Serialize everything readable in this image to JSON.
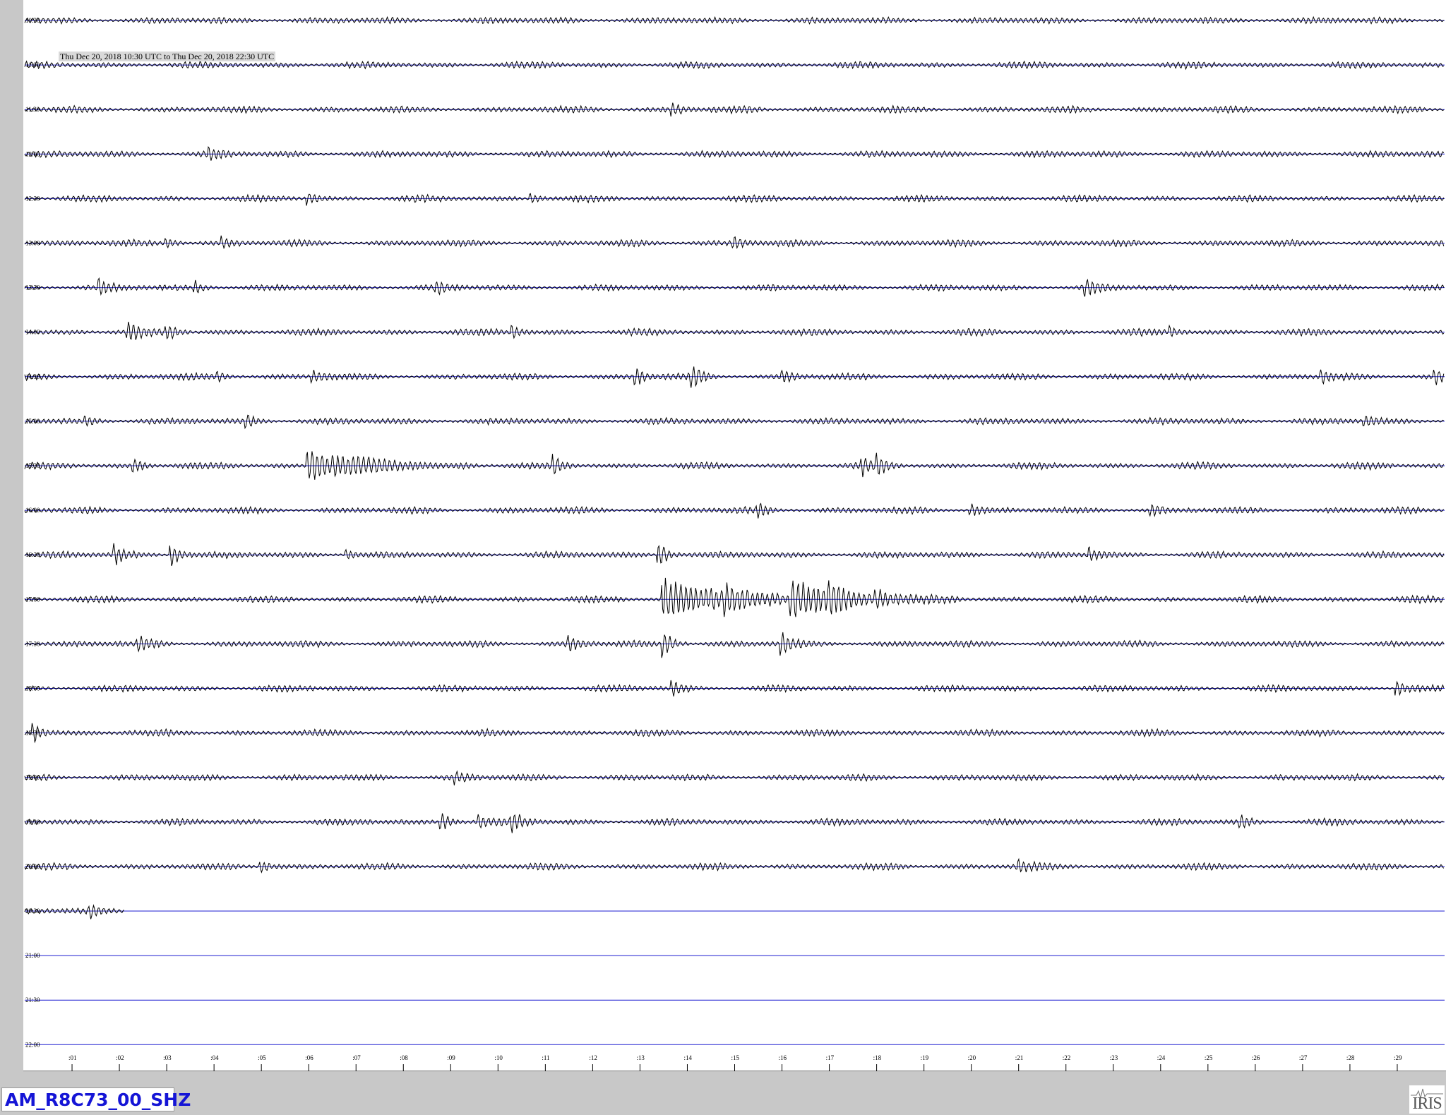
{
  "range_label": "Thu Dec 20, 2018 10:30 UTC to Thu Dec 20, 2018 22:30 UTC",
  "station": "AM_R8C73_00_SHZ",
  "logo_text": "IRIS",
  "colors": {
    "trace": "#000000",
    "baseline": "#1d1dd0",
    "background": "#ffffff",
    "frame": "#c8c8c8",
    "station_text": "#1515d6"
  },
  "chart_data": {
    "type": "line",
    "title": "",
    "x_axis_unit": "minutes after row start",
    "xlim": [
      0,
      30
    ],
    "x_ticks": [
      ":01",
      ":02",
      ":03",
      ":04",
      ":05",
      ":06",
      ":07",
      ":08",
      ":09",
      ":10",
      ":11",
      ":12",
      ":13",
      ":14",
      ":15",
      ":16",
      ":17",
      ":18",
      ":19",
      ":20",
      ":21",
      ":22",
      ":23",
      ":24",
      ":25",
      ":26",
      ":27",
      ":28",
      ":29"
    ],
    "rows": [
      {
        "label": "10:30",
        "data_end_min": 30,
        "events": []
      },
      {
        "label": "11:00",
        "data_end_min": 30,
        "events": []
      },
      {
        "label": "11:30",
        "data_end_min": 30,
        "events": [
          {
            "min": 13.7,
            "amp": 1.2
          }
        ]
      },
      {
        "label": "12:00",
        "data_end_min": 30,
        "events": [
          {
            "min": 3.9,
            "amp": 1.4
          }
        ]
      },
      {
        "label": "12:30",
        "data_end_min": 30,
        "events": [
          {
            "min": 6.0,
            "amp": 1.2
          },
          {
            "min": 10.7,
            "amp": 1.2
          }
        ]
      },
      {
        "label": "13:00",
        "data_end_min": 30,
        "events": [
          {
            "min": 3.0,
            "amp": 1.0
          },
          {
            "min": 4.2,
            "amp": 1.1
          },
          {
            "min": 15.0,
            "amp": 1.2
          }
        ]
      },
      {
        "label": "13:30",
        "data_end_min": 30,
        "events": [
          {
            "min": 1.6,
            "amp": 1.6
          },
          {
            "min": 3.6,
            "amp": 1.3
          },
          {
            "min": 8.7,
            "amp": 1.2
          },
          {
            "min": 22.4,
            "amp": 2.0
          }
        ]
      },
      {
        "label": "14:00",
        "data_end_min": 30,
        "events": [
          {
            "min": 2.2,
            "amp": 2.0
          },
          {
            "min": 3.0,
            "amp": 1.6
          },
          {
            "min": 10.3,
            "amp": 1.3
          },
          {
            "min": 24.2,
            "amp": 1.1
          }
        ]
      },
      {
        "label": "14:30",
        "data_end_min": 30,
        "events": [
          {
            "min": 4.1,
            "amp": 1.1
          },
          {
            "min": 6.1,
            "amp": 1.4
          },
          {
            "min": 12.9,
            "amp": 2.2
          },
          {
            "min": 14.1,
            "amp": 2.4
          },
          {
            "min": 16.0,
            "amp": 1.2
          },
          {
            "min": 27.4,
            "amp": 1.3
          },
          {
            "min": 29.8,
            "amp": 1.5
          }
        ]
      },
      {
        "label": "15:00",
        "data_end_min": 30,
        "events": [
          {
            "min": 1.3,
            "amp": 1.2
          },
          {
            "min": 4.7,
            "amp": 1.3
          },
          {
            "min": 28.3,
            "amp": 1.3
          }
        ]
      },
      {
        "label": "15:30",
        "data_end_min": 30,
        "events": [
          {
            "min": 2.3,
            "amp": 1.8
          },
          {
            "min": 6.0,
            "amp": 3.4
          },
          {
            "min": 11.2,
            "amp": 1.9
          },
          {
            "min": 17.7,
            "amp": 2.0
          },
          {
            "min": 18.0,
            "amp": 1.8
          }
        ]
      },
      {
        "label": "16:00",
        "data_end_min": 30,
        "events": [
          {
            "min": 15.5,
            "amp": 1.2
          },
          {
            "min": 20.0,
            "amp": 1.3
          },
          {
            "min": 23.8,
            "amp": 1.2
          }
        ]
      },
      {
        "label": "16:30",
        "data_end_min": 30,
        "events": [
          {
            "min": 1.9,
            "amp": 2.2
          },
          {
            "min": 3.1,
            "amp": 2.6
          },
          {
            "min": 6.8,
            "amp": 1.2
          },
          {
            "min": 13.4,
            "amp": 3.0
          },
          {
            "min": 22.5,
            "amp": 1.5
          }
        ]
      },
      {
        "label": "17:00",
        "data_end_min": 30,
        "events": [
          {
            "min": 13.5,
            "amp": 5.0
          },
          {
            "min": 14.8,
            "amp": 3.0
          },
          {
            "min": 16.2,
            "amp": 4.0
          },
          {
            "min": 17.0,
            "amp": 2.5
          },
          {
            "min": 18.0,
            "amp": 1.8
          }
        ]
      },
      {
        "label": "17:30",
        "data_end_min": 30,
        "events": [
          {
            "min": 2.4,
            "amp": 1.6
          },
          {
            "min": 11.5,
            "amp": 1.6
          },
          {
            "min": 13.5,
            "amp": 3.0
          },
          {
            "min": 16.0,
            "amp": 2.2
          }
        ]
      },
      {
        "label": "18:00",
        "data_end_min": 30,
        "events": [
          {
            "min": 13.7,
            "amp": 1.5
          },
          {
            "min": 29.0,
            "amp": 1.8
          }
        ]
      },
      {
        "label": "18:30",
        "data_end_min": 30,
        "events": [
          {
            "min": 0.2,
            "amp": 2.2
          }
        ]
      },
      {
        "label": "19:00",
        "data_end_min": 30,
        "events": [
          {
            "min": 9.1,
            "amp": 1.2
          }
        ]
      },
      {
        "label": "19:30",
        "data_end_min": 30,
        "events": [
          {
            "min": 8.8,
            "amp": 2.2
          },
          {
            "min": 9.6,
            "amp": 1.4
          },
          {
            "min": 10.3,
            "amp": 2.4
          },
          {
            "min": 25.7,
            "amp": 1.2
          }
        ]
      },
      {
        "label": "20:00",
        "data_end_min": 30,
        "events": [
          {
            "min": 5.0,
            "amp": 1.4
          },
          {
            "min": 21.0,
            "amp": 1.2
          }
        ]
      },
      {
        "label": "20:30",
        "data_end_min": 2.1,
        "events": [
          {
            "min": 1.4,
            "amp": 1.1
          }
        ]
      },
      {
        "label": "21:00",
        "data_end_min": 0,
        "events": []
      },
      {
        "label": "21:30",
        "data_end_min": 0,
        "events": []
      },
      {
        "label": "22:00",
        "data_end_min": 0,
        "events": []
      }
    ]
  }
}
